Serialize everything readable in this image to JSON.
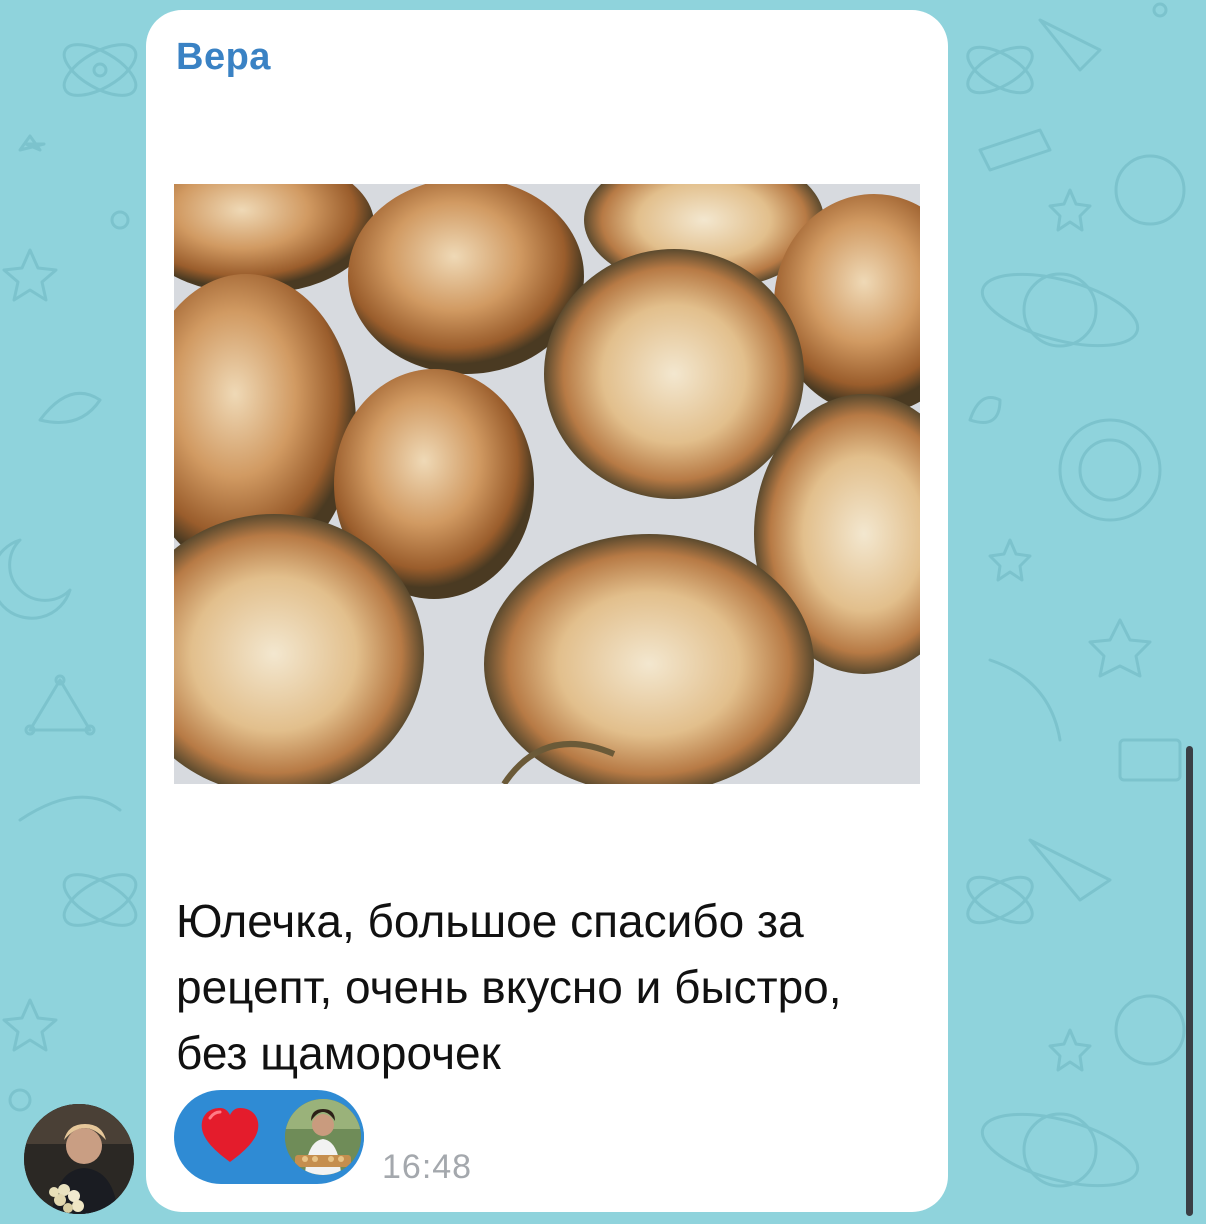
{
  "chat": {
    "wallpaper": "space-doodle-pattern",
    "wallpaper_color": "#8fd3dc"
  },
  "message": {
    "sender_name": "Вера",
    "sender_color": "#3a82c4",
    "photo_description": "fried zucchini slices",
    "text": "Юлечка, большое спасибо за рецепт, очень вкусно и быстро, без щаморочек",
    "time": "16:48"
  },
  "reaction": {
    "emoji": "heart-icon",
    "color": "#2f8bd4"
  }
}
